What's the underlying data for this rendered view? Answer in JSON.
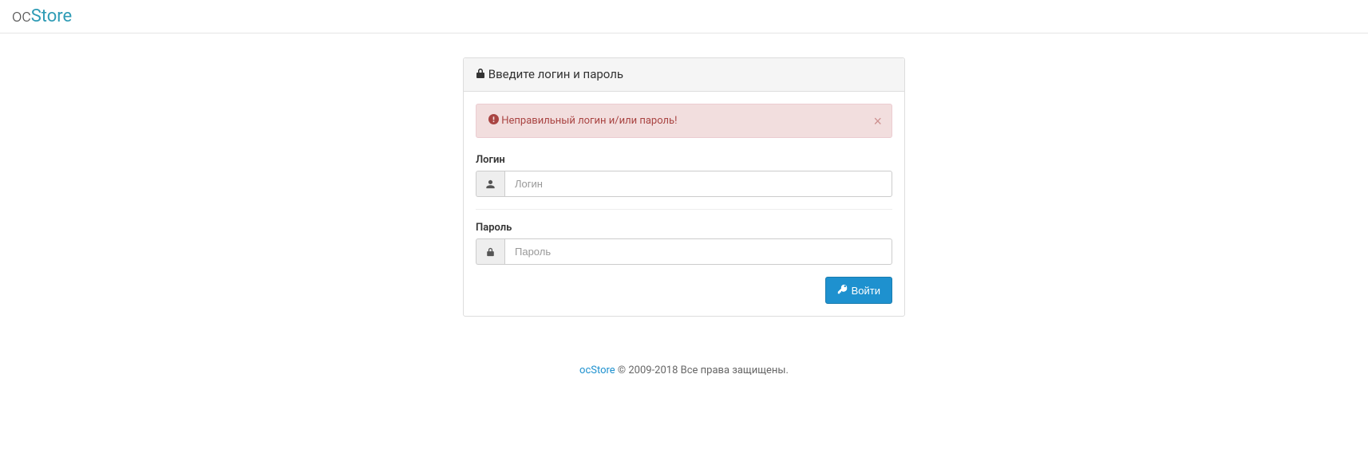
{
  "header": {
    "logo_prefix": "oc",
    "logo_suffix": "Store"
  },
  "panel": {
    "title": "Введите логин и пароль"
  },
  "alert": {
    "message": "Неправильный логин и/или пароль!"
  },
  "form": {
    "username": {
      "label": "Логин",
      "placeholder": "Логин",
      "value": ""
    },
    "password": {
      "label": "Пароль",
      "placeholder": "Пароль",
      "value": ""
    },
    "submit_label": "Войти"
  },
  "footer": {
    "link_text": "ocStore",
    "copyright": " © 2009-2018 Все права защищены."
  }
}
